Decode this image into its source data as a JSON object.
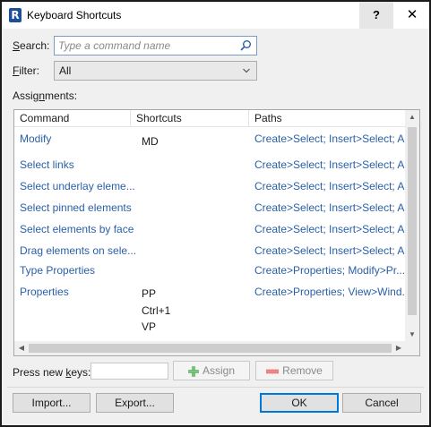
{
  "window": {
    "title": "Keyboard Shortcuts",
    "help_label": "?",
    "close_label": "✕"
  },
  "search": {
    "label": "Search:",
    "placeholder": "Type a command name",
    "value": ""
  },
  "filter": {
    "label": "Filter:",
    "value": "All"
  },
  "assignments": {
    "label": "Assignments:",
    "columns": [
      "Command",
      "Shortcuts",
      "Paths"
    ],
    "rows": [
      {
        "command": "Modify",
        "shortcuts": [
          "MD"
        ],
        "paths": "Create>Select; Insert>Select; A..."
      },
      {
        "command": "Select links",
        "shortcuts": [],
        "paths": "Create>Select; Insert>Select; A..."
      },
      {
        "command": "Select underlay eleme...",
        "shortcuts": [],
        "paths": "Create>Select; Insert>Select; A..."
      },
      {
        "command": "Select pinned elements",
        "shortcuts": [],
        "paths": "Create>Select; Insert>Select; A..."
      },
      {
        "command": "Select elements by face",
        "shortcuts": [],
        "paths": "Create>Select; Insert>Select; A..."
      },
      {
        "command": "Drag elements on sele...",
        "shortcuts": [],
        "paths": "Create>Select; Insert>Select; A..."
      },
      {
        "command": "Type Properties",
        "shortcuts": [],
        "paths": "Create>Properties; Modify>Pr..."
      },
      {
        "command": "Properties",
        "shortcuts": [
          "PP",
          "Ctrl+1",
          "VP"
        ],
        "paths": "Create>Properties; View>Wind..."
      }
    ]
  },
  "keys": {
    "label": "Press new keys:",
    "value": ""
  },
  "buttons": {
    "assign": "Assign",
    "remove": "Remove",
    "import": "Import...",
    "export": "Export...",
    "ok": "OK",
    "cancel": "Cancel"
  },
  "colors": {
    "link_blue": "#2a5fa8",
    "app_icon": "#1f4e99",
    "assign_icon": "#4caf50",
    "remove_icon": "#e05a5a"
  },
  "icons": {
    "app": "revit-r-icon",
    "search": "magnifier-icon",
    "filter": "chevron-down-icon",
    "assign": "plus-icon",
    "remove": "minus-icon"
  }
}
